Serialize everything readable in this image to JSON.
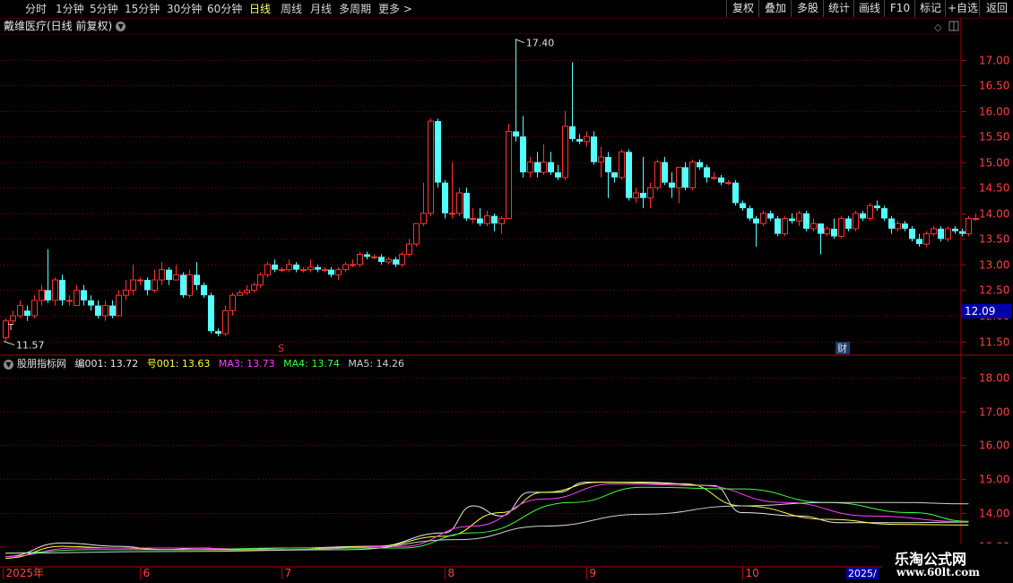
{
  "toolbar": {
    "periods": [
      "分时",
      "1分钟",
      "5分钟",
      "15分钟",
      "30分钟",
      "60分钟",
      "日线",
      "周线",
      "月线",
      "多周期",
      "更多 >"
    ],
    "active_period": "日线",
    "right_buttons": [
      "复权",
      "叠加",
      "多股",
      "统计",
      "画线",
      "F10",
      "+自选",
      "返回"
    ],
    "mark_button": "标记"
  },
  "stock": {
    "title": "戴维医疗(日线 前复权)",
    "dropdown_icon": "chevron-down-icon"
  },
  "indicator": {
    "name": "股朋指标网",
    "values": [
      {
        "label": "编001: 13.72",
        "color": "#e8e8e8"
      },
      {
        "label": "号001: 13.63",
        "color": "#ffff40"
      },
      {
        "label": "MA3: 13.73",
        "color": "#ff40ff"
      },
      {
        "label": "MA4: 13.74",
        "color": "#40ff40"
      },
      {
        "label": "MA5: 14.26",
        "color": "#d0d0d0"
      }
    ]
  },
  "markers": {
    "high_label": "17.40",
    "low_label": "11.57",
    "current_price": "12.09",
    "s_mark": "S",
    "t_mark": "T",
    "cai_mark": "财"
  },
  "x_axis": {
    "labels": [
      {
        "text": "2025年",
        "idx": 0
      },
      {
        "text": "6",
        "idx": 19
      },
      {
        "text": "7",
        "idx": 39
      },
      {
        "text": "8",
        "idx": 62
      },
      {
        "text": "9",
        "idx": 82
      },
      {
        "text": "10",
        "idx": 104
      }
    ],
    "cursor_label": "2025/"
  },
  "logo": {
    "line1": "乐淘公式网",
    "line2": "www.60lt.com"
  },
  "colors": {
    "up": "#ff3232",
    "down": "#54ffff",
    "grid": "#7a0000",
    "axis": "#b00000",
    "label": "#ff4040",
    "cursor_bg": "#0000a8"
  },
  "chart_data": [
    {
      "type": "candlestick",
      "title": "戴维医疗(日线 前复权)",
      "ylim": [
        11.3,
        17.5
      ],
      "y_ticks": [
        11.5,
        12.0,
        12.5,
        13.0,
        13.5,
        14.0,
        14.5,
        15.0,
        15.5,
        16.0,
        16.5,
        17.0
      ],
      "candles": [
        [
          11.57,
          11.9,
          11.5,
          11.95
        ],
        [
          11.9,
          12.0,
          11.85,
          12.1
        ],
        [
          12.0,
          12.2,
          11.95,
          12.3
        ],
        [
          12.1,
          12.0,
          11.9,
          12.2
        ],
        [
          12.0,
          12.3,
          11.95,
          12.4
        ],
        [
          12.3,
          12.5,
          12.2,
          12.6
        ],
        [
          12.5,
          12.3,
          12.25,
          13.3
        ],
        [
          12.3,
          12.7,
          12.2,
          12.75
        ],
        [
          12.7,
          12.3,
          12.2,
          12.8
        ],
        [
          12.3,
          12.3,
          12.2,
          12.4
        ],
        [
          12.2,
          12.5,
          12.2,
          12.6
        ],
        [
          12.5,
          12.3,
          12.2,
          12.6
        ],
        [
          12.3,
          12.2,
          12.1,
          12.4
        ],
        [
          12.2,
          12.0,
          11.95,
          12.3
        ],
        [
          12.0,
          12.2,
          11.9,
          12.3
        ],
        [
          12.2,
          12.0,
          11.95,
          12.3
        ],
        [
          12.0,
          12.4,
          12.0,
          12.5
        ],
        [
          12.4,
          12.5,
          12.3,
          12.7
        ],
        [
          12.5,
          12.7,
          12.4,
          13.0
        ],
        [
          12.7,
          12.7,
          12.6,
          12.75
        ],
        [
          12.7,
          12.5,
          12.4,
          12.75
        ],
        [
          12.5,
          12.7,
          12.45,
          12.9
        ],
        [
          12.7,
          12.9,
          12.6,
          13.05
        ],
        [
          12.9,
          12.7,
          12.6,
          12.95
        ],
        [
          12.7,
          12.8,
          12.7,
          13.0
        ],
        [
          12.8,
          12.4,
          12.35,
          12.85
        ],
        [
          12.4,
          12.8,
          12.35,
          12.9
        ],
        [
          12.8,
          12.6,
          12.5,
          13.05
        ],
        [
          12.6,
          12.4,
          12.35,
          12.65
        ],
        [
          12.4,
          11.7,
          11.65,
          12.45
        ],
        [
          11.7,
          11.65,
          11.6,
          11.75
        ],
        [
          11.65,
          12.1,
          11.6,
          12.2
        ],
        [
          12.1,
          12.4,
          12.0,
          12.45
        ],
        [
          12.4,
          12.45,
          12.4,
          12.5
        ],
        [
          12.45,
          12.5,
          12.4,
          12.6
        ],
        [
          12.5,
          12.6,
          12.45,
          12.65
        ],
        [
          12.6,
          12.8,
          12.55,
          12.85
        ],
        [
          12.8,
          13.0,
          12.75,
          13.05
        ],
        [
          13.0,
          12.9,
          12.85,
          13.1
        ],
        [
          12.9,
          12.9,
          12.85,
          12.95
        ],
        [
          12.9,
          13.0,
          12.85,
          13.1
        ],
        [
          13.0,
          12.9,
          12.85,
          13.05
        ],
        [
          12.9,
          12.9,
          12.85,
          12.95
        ],
        [
          12.9,
          12.95,
          12.85,
          13.1
        ],
        [
          12.95,
          12.9,
          12.85,
          13.0
        ],
        [
          12.9,
          12.9,
          12.85,
          12.95
        ],
        [
          12.9,
          12.8,
          12.75,
          12.95
        ],
        [
          12.8,
          12.9,
          12.7,
          12.95
        ],
        [
          12.9,
          13.0,
          12.85,
          13.05
        ],
        [
          13.0,
          13.0,
          12.95,
          13.1
        ],
        [
          13.0,
          13.2,
          12.95,
          13.25
        ],
        [
          13.2,
          13.15,
          13.1,
          13.25
        ],
        [
          13.15,
          13.15,
          13.1,
          13.2
        ],
        [
          13.15,
          13.05,
          13.0,
          13.2
        ],
        [
          13.05,
          13.1,
          13.0,
          13.15
        ],
        [
          13.1,
          13.0,
          12.95,
          13.15
        ],
        [
          13.0,
          13.2,
          12.95,
          13.25
        ],
        [
          13.2,
          13.4,
          13.15,
          13.5
        ],
        [
          13.4,
          13.8,
          13.35,
          13.8
        ],
        [
          13.8,
          14.0,
          13.75,
          14.6
        ],
        [
          14.0,
          15.8,
          13.95,
          15.85
        ],
        [
          15.8,
          14.6,
          14.5,
          15.85
        ],
        [
          14.6,
          14.0,
          13.9,
          14.65
        ],
        [
          14.0,
          14.0,
          13.9,
          15.0
        ],
        [
          14.0,
          14.4,
          13.95,
          14.5
        ],
        [
          14.4,
          13.9,
          13.85,
          14.5
        ],
        [
          13.9,
          13.9,
          13.8,
          14.1
        ],
        [
          13.9,
          13.8,
          13.75,
          14.1
        ],
        [
          13.8,
          13.95,
          13.75,
          14.05
        ],
        [
          13.95,
          13.8,
          13.65,
          14.0
        ],
        [
          13.8,
          13.9,
          13.6,
          13.95
        ],
        [
          13.9,
          15.6,
          13.9,
          15.75
        ],
        [
          15.6,
          15.5,
          15.4,
          17.4
        ],
        [
          15.5,
          14.8,
          14.7,
          15.9
        ],
        [
          14.8,
          15.0,
          14.7,
          15.1
        ],
        [
          15.0,
          14.8,
          14.7,
          15.2
        ],
        [
          14.8,
          15.0,
          14.75,
          15.35
        ],
        [
          15.0,
          14.8,
          14.75,
          15.2
        ],
        [
          14.8,
          14.7,
          14.65,
          14.95
        ],
        [
          14.7,
          15.7,
          14.65,
          16.0
        ],
        [
          15.7,
          15.45,
          15.4,
          16.95
        ],
        [
          15.45,
          15.4,
          15.35,
          15.55
        ],
        [
          15.4,
          15.5,
          15.3,
          15.6
        ],
        [
          15.5,
          15.0,
          14.95,
          15.6
        ],
        [
          15.0,
          15.1,
          14.7,
          15.3
        ],
        [
          15.1,
          14.8,
          14.3,
          15.2
        ],
        [
          14.8,
          14.7,
          14.6,
          14.8
        ],
        [
          14.7,
          15.2,
          14.65,
          15.25
        ],
        [
          15.2,
          14.3,
          14.25,
          15.25
        ],
        [
          14.3,
          14.4,
          14.2,
          14.5
        ],
        [
          14.4,
          14.3,
          14.1,
          15.1
        ],
        [
          14.3,
          14.5,
          14.1,
          14.6
        ],
        [
          14.5,
          15.0,
          14.45,
          15.05
        ],
        [
          15.0,
          14.6,
          14.55,
          15.1
        ],
        [
          14.6,
          14.5,
          14.3,
          14.8
        ],
        [
          14.5,
          14.9,
          14.2,
          14.9
        ],
        [
          14.9,
          14.5,
          14.45,
          15.0
        ],
        [
          14.5,
          15.0,
          14.45,
          15.05
        ],
        [
          15.0,
          14.9,
          14.85,
          15.05
        ],
        [
          14.9,
          14.7,
          14.6,
          14.95
        ],
        [
          14.7,
          14.7,
          14.65,
          14.8
        ],
        [
          14.7,
          14.6,
          14.55,
          14.75
        ],
        [
          14.6,
          14.6,
          14.55,
          14.65
        ],
        [
          14.6,
          14.2,
          14.15,
          14.65
        ],
        [
          14.2,
          14.1,
          14.05,
          14.25
        ],
        [
          14.1,
          13.9,
          13.85,
          14.15
        ],
        [
          13.9,
          13.8,
          13.35,
          13.95
        ],
        [
          13.8,
          14.0,
          13.75,
          14.05
        ],
        [
          14.0,
          13.9,
          13.85,
          14.05
        ],
        [
          13.9,
          13.6,
          13.55,
          13.95
        ],
        [
          13.6,
          13.9,
          13.55,
          13.95
        ],
        [
          13.9,
          13.85,
          13.8,
          14.0
        ],
        [
          13.85,
          14.0,
          13.75,
          14.05
        ],
        [
          14.0,
          13.7,
          13.65,
          14.05
        ],
        [
          13.7,
          13.8,
          13.65,
          13.9
        ],
        [
          13.8,
          13.6,
          13.2,
          13.8
        ],
        [
          13.6,
          13.7,
          13.55,
          13.75
        ],
        [
          13.7,
          13.55,
          13.5,
          13.9
        ],
        [
          13.55,
          13.9,
          13.5,
          13.95
        ],
        [
          13.9,
          13.7,
          13.65,
          13.95
        ],
        [
          13.7,
          14.0,
          13.65,
          14.05
        ],
        [
          14.0,
          13.9,
          13.85,
          14.05
        ],
        [
          13.9,
          14.15,
          13.85,
          14.2
        ],
        [
          14.15,
          14.1,
          14.05,
          14.25
        ],
        [
          14.1,
          13.9,
          13.85,
          14.15
        ],
        [
          13.9,
          13.7,
          13.6,
          13.95
        ],
        [
          13.7,
          13.8,
          13.65,
          13.85
        ],
        [
          13.8,
          13.7,
          13.65,
          13.85
        ],
        [
          13.7,
          13.5,
          13.45,
          13.75
        ],
        [
          13.5,
          13.4,
          13.35,
          13.6
        ],
        [
          13.4,
          13.6,
          13.35,
          13.65
        ],
        [
          13.6,
          13.7,
          13.55,
          13.75
        ],
        [
          13.7,
          13.5,
          13.45,
          13.75
        ],
        [
          13.5,
          13.7,
          13.45,
          13.75
        ],
        [
          13.7,
          13.65,
          13.6,
          13.75
        ],
        [
          13.65,
          13.6,
          13.55,
          13.7
        ],
        [
          13.6,
          13.9,
          13.55,
          13.95
        ],
        [
          13.9,
          13.9,
          13.85,
          14.0
        ]
      ]
    },
    {
      "type": "line",
      "title": "股朋指标网",
      "ylim": [
        12.5,
        18.5
      ],
      "y_ticks": [
        13.0,
        14.0,
        15.0,
        16.0,
        17.0,
        18.0
      ],
      "series": [
        {
          "name": "编001",
          "color": "#e8e8e8",
          "points": [
            [
              0,
              12.7
            ],
            [
              8,
              13.1
            ],
            [
              16,
              13.0
            ],
            [
              22,
              12.9
            ],
            [
              28,
              12.95
            ],
            [
              32,
              12.9
            ],
            [
              40,
              12.95
            ],
            [
              52,
              13.0
            ],
            [
              62,
              13.4
            ],
            [
              66,
              14.2
            ],
            [
              70,
              13.9
            ],
            [
              74,
              14.6
            ],
            [
              78,
              14.6
            ],
            [
              82,
              14.9
            ],
            [
              90,
              14.9
            ],
            [
              100,
              14.8
            ],
            [
              104,
              14.0
            ],
            [
              112,
              13.9
            ],
            [
              118,
              13.7
            ],
            [
              126,
              13.7
            ],
            [
              136,
              13.72
            ]
          ]
        },
        {
          "name": "号001",
          "color": "#ffff40",
          "points": [
            [
              0,
              12.65
            ],
            [
              8,
              13.0
            ],
            [
              16,
              12.95
            ],
            [
              24,
              12.9
            ],
            [
              32,
              12.9
            ],
            [
              40,
              12.9
            ],
            [
              52,
              13.0
            ],
            [
              62,
              13.3
            ],
            [
              70,
              14.0
            ],
            [
              76,
              14.6
            ],
            [
              84,
              14.9
            ],
            [
              96,
              14.85
            ],
            [
              104,
              14.2
            ],
            [
              116,
              13.8
            ],
            [
              126,
              13.65
            ],
            [
              136,
              13.63
            ]
          ]
        },
        {
          "name": "MA3",
          "color": "#ff40ff",
          "points": [
            [
              0,
              12.7
            ],
            [
              10,
              12.95
            ],
            [
              24,
              12.95
            ],
            [
              40,
              12.9
            ],
            [
              56,
              13.0
            ],
            [
              66,
              13.6
            ],
            [
              76,
              14.4
            ],
            [
              86,
              14.85
            ],
            [
              98,
              14.8
            ],
            [
              110,
              14.3
            ],
            [
              122,
              13.9
            ],
            [
              136,
              13.73
            ]
          ]
        },
        {
          "name": "MA4",
          "color": "#40ff40",
          "points": [
            [
              0,
              12.8
            ],
            [
              12,
              12.9
            ],
            [
              24,
              12.9
            ],
            [
              40,
              12.95
            ],
            [
              56,
              12.95
            ],
            [
              66,
              13.4
            ],
            [
              80,
              14.3
            ],
            [
              90,
              14.75
            ],
            [
              104,
              14.7
            ],
            [
              116,
              14.3
            ],
            [
              128,
              14.0
            ],
            [
              136,
              13.74
            ]
          ]
        },
        {
          "name": "MA5",
          "color": "#d0d0d0",
          "points": [
            [
              0,
              12.8
            ],
            [
              24,
              12.85
            ],
            [
              48,
              12.9
            ],
            [
              64,
              13.2
            ],
            [
              76,
              13.6
            ],
            [
              90,
              13.95
            ],
            [
              104,
              14.2
            ],
            [
              116,
              14.3
            ],
            [
              126,
              14.3
            ],
            [
              136,
              14.26
            ]
          ]
        }
      ]
    }
  ]
}
